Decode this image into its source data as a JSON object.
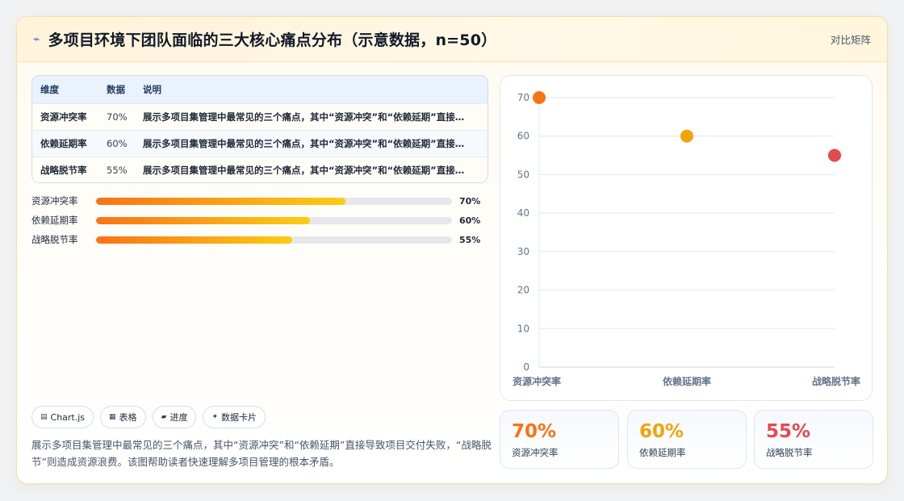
{
  "header": {
    "logo_icon": "chart-pulse-icon",
    "title": "多项目环境下团队面临的三大核心痛点分布（示意数据，n=50）",
    "right_link": "对比矩阵"
  },
  "table": {
    "headers": [
      "维度",
      "数据",
      "说明"
    ],
    "rows": [
      {
        "dim": "资源冲突率",
        "value": "70%",
        "note": "展示多项目集管理中最常见的三个痛点，其中“资源冲突”和“依赖延期”直接导致项目交付失败，“战略脱节”则造成资源浪费。该图帮助读者快速理解多项目管理的根本矛盾。"
      },
      {
        "dim": "依赖延期率",
        "value": "60%",
        "note": "展示多项目集管理中最常见的三个痛点，其中“资源冲突”和“依赖延期”直接导致项目交付失败，“战略脱节”则造成资源浪费。该图帮助读者快速理解多项目管理的根本矛盾。"
      },
      {
        "dim": "战略脱节率",
        "value": "55%",
        "note": "展示多项目集管理中最常见的三个痛点，其中“资源冲突”和“依赖延期”直接导致项目交付失败，“战略脱节”则造成资源浪费。该图帮助读者快速理解多项目管理的根本矛盾。"
      }
    ]
  },
  "progress": [
    {
      "label": "资源冲突率",
      "value": 70,
      "display": "70%"
    },
    {
      "label": "依赖延期率",
      "value": 60,
      "display": "60%"
    },
    {
      "label": "战略脱节率",
      "value": 55,
      "display": "55%"
    }
  ],
  "chips": [
    {
      "icon": "monitor-icon",
      "glyph": "▤",
      "label": "Chart.js"
    },
    {
      "icon": "table-icon",
      "glyph": "▦",
      "label": "表格"
    },
    {
      "icon": "progress-icon",
      "glyph": "▰",
      "label": "进度"
    },
    {
      "icon": "sparkle-icon",
      "glyph": "✦",
      "label": "数据卡片"
    }
  ],
  "description": "展示多项目集管理中最常见的三个痛点，其中“资源冲突”和“依赖延期”直接导致项目交付失败，“战略脱节”则造成资源浪费。该图帮助读者快速理解多项目管理的根本矛盾。",
  "chart_data": {
    "type": "scatter",
    "categories": [
      "资源冲突率",
      "依赖延期率",
      "战略脱节率"
    ],
    "values": [
      70,
      60,
      55
    ],
    "colors": [
      "#f97316",
      "#f0a30a",
      "#e5484d"
    ],
    "ylim": [
      0,
      70
    ],
    "yticks": [
      0,
      10,
      20,
      30,
      40,
      50,
      60,
      70
    ],
    "grid": true,
    "title": "",
    "xlabel": "",
    "ylabel": ""
  },
  "stats": [
    {
      "value": "70%",
      "label": "资源冲突率",
      "color": "#f97316"
    },
    {
      "value": "60%",
      "label": "依赖延期率",
      "color": "#f0a30a"
    },
    {
      "value": "55%",
      "label": "战略脱节率",
      "color": "#e5484d"
    }
  ]
}
